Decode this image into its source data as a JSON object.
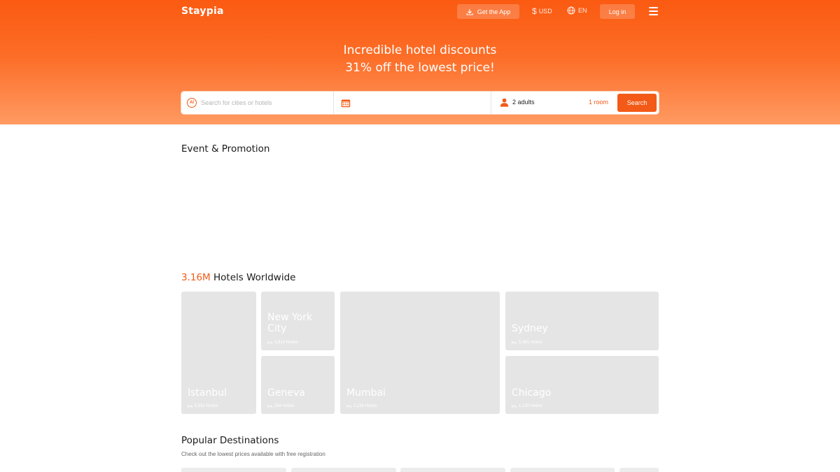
{
  "header": {
    "logo": "Staypia",
    "get_app_label": "Get the App",
    "currency": "USD",
    "currency_symbol": "$",
    "language": "EN",
    "login_label": "Log in"
  },
  "hero": {
    "line1": "Incredible hotel discounts",
    "line2": "31% off the lowest price!"
  },
  "search": {
    "placeholder": "Search for cities or hotels",
    "ai_badge": "AI",
    "adults": "2 adults",
    "rooms": "1 room",
    "button_label": "Search"
  },
  "event": {
    "title": "Event & Promotion"
  },
  "worldwide": {
    "count": "3.16M",
    "title": "Hotels Worldwide",
    "cities": [
      {
        "name": "Istanbul",
        "hotels": "5,551 Hotels"
      },
      {
        "name": "New York City",
        "hotels": "3,914 Hotels"
      },
      {
        "name": "Geneva",
        "hotels": "254 Hotels"
      },
      {
        "name": "Mumbai",
        "hotels": "2,156 Hotels"
      },
      {
        "name": "Sydney",
        "hotels": "5,481 Hotels"
      },
      {
        "name": "Chicago",
        "hotels": "1,130 Hotels"
      }
    ]
  },
  "popular": {
    "title": "Popular Destinations",
    "subtitle": "Check out the lowest prices available with free registration"
  },
  "colors": {
    "brand": "#f35a17",
    "placeholder_card": "#e5e5e5"
  }
}
